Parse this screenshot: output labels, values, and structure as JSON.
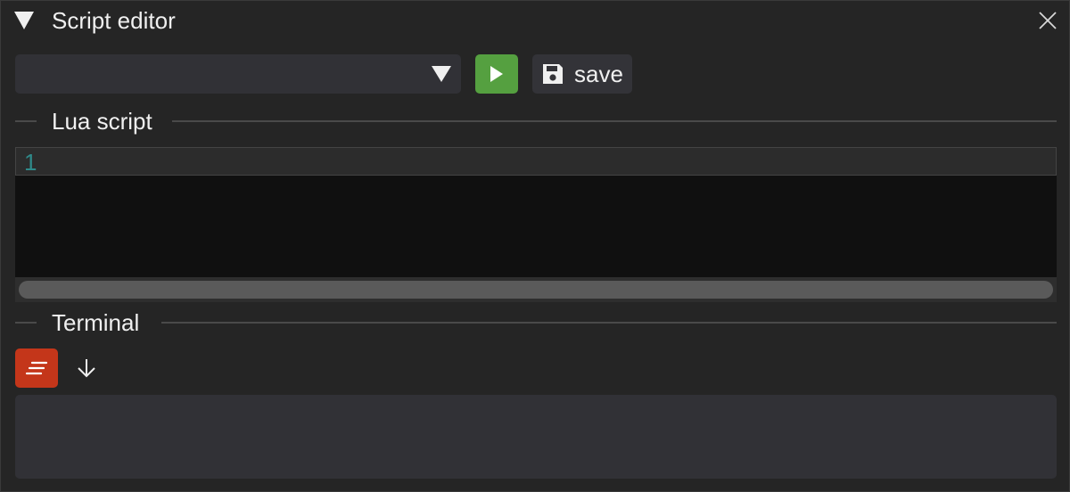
{
  "window": {
    "title": "Script editor",
    "collapse_icon": "triangle-down-icon",
    "close_icon": "close-icon"
  },
  "toolbar": {
    "script_select": {
      "selected": "",
      "options_icon": "triangle-down-icon"
    },
    "run_icon": "play-icon",
    "run_color": "#55a040",
    "save_label": "save",
    "save_icon": "floppy-disk-icon"
  },
  "lua_section": {
    "title": "Lua script",
    "lines": [
      {
        "number": "1",
        "text": ""
      }
    ]
  },
  "terminal_section": {
    "title": "Terminal",
    "clear_icon": "clear-lines-icon",
    "clear_color": "#c4361a",
    "scroll_icon": "arrow-down-icon",
    "output": ""
  }
}
